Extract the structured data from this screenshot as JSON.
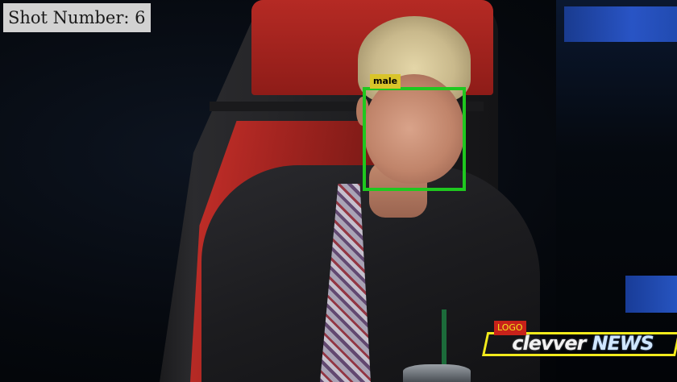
{
  "overlay": {
    "shot_label": "Shot Number: 6"
  },
  "detections": [
    {
      "label": "male",
      "box_color": "#1fc81f",
      "tag_color": "#d9c42a"
    },
    {
      "label": "LOGO",
      "box_color": "#f2ea1c",
      "tag_color": "#c8221a"
    }
  ],
  "watermark": {
    "brand": "clevver",
    "word": "NEWS"
  }
}
